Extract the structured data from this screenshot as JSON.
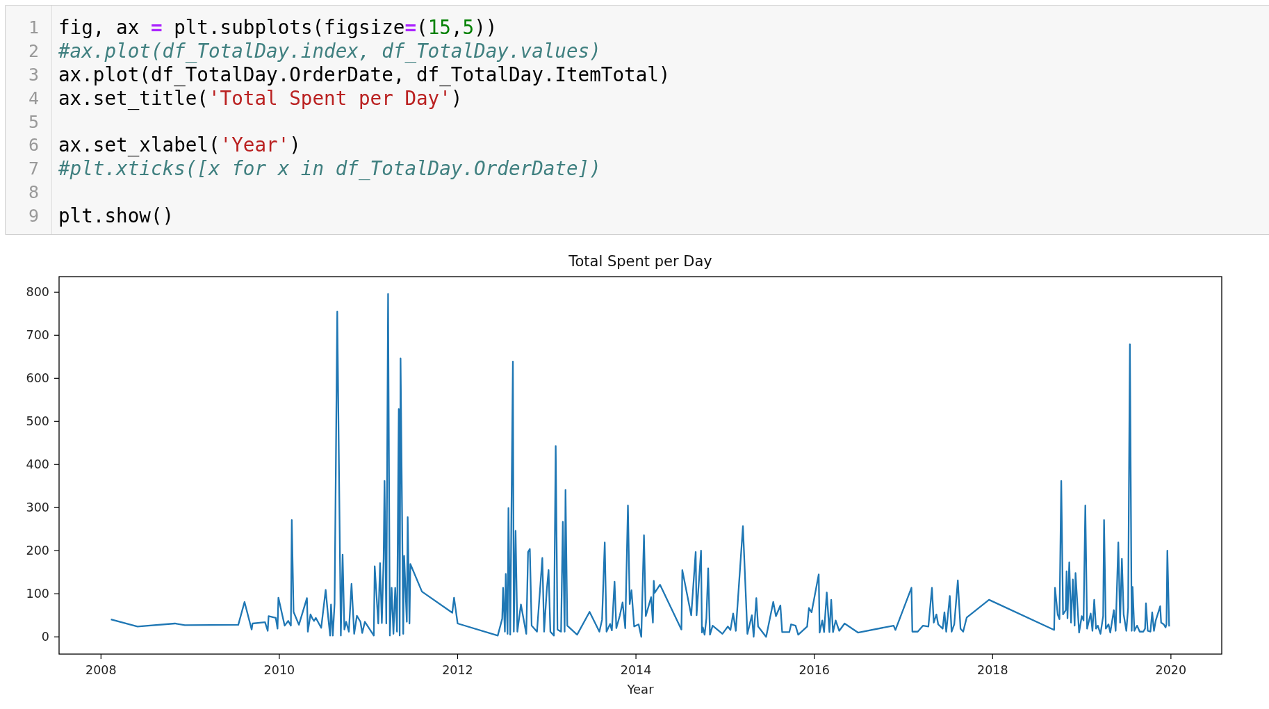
{
  "code_cell": {
    "lines": [
      {
        "number": "1",
        "tokens": [
          {
            "kind": "plain",
            "text": "fig, ax "
          },
          {
            "kind": "operator",
            "text": "="
          },
          {
            "kind": "plain",
            "text": " plt.subplots(figsize"
          },
          {
            "kind": "operator",
            "text": "="
          },
          {
            "kind": "plain",
            "text": "("
          },
          {
            "kind": "number",
            "text": "15"
          },
          {
            "kind": "plain",
            "text": ","
          },
          {
            "kind": "number",
            "text": "5"
          },
          {
            "kind": "plain",
            "text": "))"
          }
        ]
      },
      {
        "number": "2",
        "tokens": [
          {
            "kind": "comment",
            "text": "#ax.plot(df_TotalDay.index, df_TotalDay.values)"
          }
        ]
      },
      {
        "number": "3",
        "tokens": [
          {
            "kind": "plain",
            "text": "ax.plot(df_TotalDay.OrderDate, df_TotalDay.ItemTotal)"
          }
        ]
      },
      {
        "number": "4",
        "tokens": [
          {
            "kind": "plain",
            "text": "ax.set_title("
          },
          {
            "kind": "string",
            "text": "'Total Spent per Day'"
          },
          {
            "kind": "plain",
            "text": ")"
          }
        ]
      },
      {
        "number": "5"
      },
      {
        "number": "6",
        "tokens": [
          {
            "kind": "plain",
            "text": "ax.set_xlabel("
          },
          {
            "kind": "string",
            "text": "'Year'"
          },
          {
            "kind": "plain",
            "text": ")"
          }
        ]
      },
      {
        "number": "7",
        "tokens": [
          {
            "kind": "comment",
            "text": "#plt.xticks([x for x in df_TotalDay.OrderDate])"
          }
        ]
      },
      {
        "number": "8"
      },
      {
        "number": "9",
        "tokens": [
          {
            "kind": "plain",
            "text": "plt.show()"
          }
        ]
      }
    ]
  },
  "output": {
    "chart_data": {
      "type": "line",
      "title": "Total Spent per Day",
      "xlabel": "Year",
      "x": [
        2008.12,
        2008.41,
        2008.83,
        2008.94,
        2009.54,
        2009.61,
        2009.69,
        2009.7,
        2009.84,
        2009.87,
        2009.88,
        2009.96,
        2009.98,
        2009.99,
        2010.06,
        2010.1,
        2010.13,
        2010.14,
        2010.16,
        2010.22,
        2010.31,
        2010.32,
        2010.35,
        2010.37,
        2010.39,
        2010.41,
        2010.47,
        2010.52,
        2010.55,
        2010.57,
        2010.58,
        2010.6,
        2010.62,
        2010.65,
        2010.69,
        2010.71,
        2010.73,
        2010.75,
        2010.78,
        2010.81,
        2010.84,
        2010.87,
        2010.91,
        2010.93,
        2010.96,
        2011.06,
        2011.07,
        2011.11,
        2011.13,
        2011.15,
        2011.17,
        2011.18,
        2011.2,
        2011.22,
        2011.24,
        2011.26,
        2011.28,
        2011.3,
        2011.32,
        2011.34,
        2011.35,
        2011.36,
        2011.39,
        2011.4,
        2011.43,
        2011.44,
        2011.46,
        2011.47,
        2011.6,
        2011.94,
        2011.96,
        2012.0,
        2012.45,
        2012.5,
        2012.51,
        2012.53,
        2012.54,
        2012.56,
        2012.57,
        2012.59,
        2012.62,
        2012.63,
        2012.65,
        2012.67,
        2012.71,
        2012.77,
        2012.79,
        2012.81,
        2012.83,
        2012.89,
        2012.95,
        2012.97,
        2013.0,
        2013.02,
        2013.04,
        2013.08,
        2013.1,
        2013.12,
        2013.16,
        2013.18,
        2013.2,
        2013.21,
        2013.23,
        2013.34,
        2013.48,
        2013.59,
        2013.62,
        2013.65,
        2013.67,
        2013.71,
        2013.73,
        2013.76,
        2013.78,
        2013.82,
        2013.85,
        2013.88,
        2013.91,
        2013.93,
        2013.95,
        2013.98,
        2014.03,
        2014.06,
        2014.09,
        2014.11,
        2014.17,
        2014.19,
        2014.2,
        2014.21,
        2014.27,
        2014.51,
        2014.52,
        2014.62,
        2014.67,
        2014.68,
        2014.73,
        2014.74,
        2014.75,
        2014.77,
        2014.79,
        2014.81,
        2014.83,
        2014.86,
        2014.97,
        2015.03,
        2015.06,
        2015.09,
        2015.12,
        2015.2,
        2015.25,
        2015.3,
        2015.32,
        2015.35,
        2015.37,
        2015.46,
        2015.54,
        2015.57,
        2015.62,
        2015.64,
        2015.72,
        2015.74,
        2015.79,
        2015.82,
        2015.92,
        2015.94,
        2015.97,
        2016.05,
        2016.06,
        2016.09,
        2016.11,
        2016.14,
        2016.17,
        2016.19,
        2016.21,
        2016.24,
        2016.28,
        2016.34,
        2016.49,
        2016.89,
        2016.91,
        2017.09,
        2017.1,
        2017.16,
        2017.22,
        2017.28,
        2017.32,
        2017.34,
        2017.37,
        2017.39,
        2017.44,
        2017.46,
        2017.48,
        2017.52,
        2017.54,
        2017.57,
        2017.61,
        2017.64,
        2017.67,
        2017.71,
        2017.96,
        2018.69,
        2018.7,
        2018.73,
        2018.75,
        2018.77,
        2018.79,
        2018.82,
        2018.83,
        2018.84,
        2018.86,
        2018.88,
        2018.9,
        2018.92,
        2018.93,
        2018.97,
        2019.0,
        2019.02,
        2019.04,
        2019.06,
        2019.1,
        2019.12,
        2019.14,
        2019.16,
        2019.18,
        2019.21,
        2019.24,
        2019.25,
        2019.27,
        2019.3,
        2019.32,
        2019.36,
        2019.38,
        2019.41,
        2019.43,
        2019.45,
        2019.47,
        2019.5,
        2019.52,
        2019.54,
        2019.56,
        2019.57,
        2019.59,
        2019.62,
        2019.65,
        2019.69,
        2019.71,
        2019.72,
        2019.74,
        2019.77,
        2019.79,
        2019.81,
        2019.83,
        2019.88,
        2019.89,
        2019.92,
        2019.94,
        2019.95,
        2019.96,
        2019.98
      ],
      "series": [
        {
          "color": "#1f77b4",
          "values": [
            40,
            24,
            31,
            27,
            28,
            81,
            17,
            31,
            34,
            14,
            48,
            44,
            19,
            91,
            26,
            37,
            26,
            271,
            58,
            28,
            90,
            12,
            52,
            43,
            37,
            44,
            21,
            109,
            42,
            3,
            75,
            3,
            77,
            755,
            3,
            191,
            17,
            35,
            12,
            123,
            7,
            49,
            35,
            9,
            35,
            3,
            164,
            31,
            171,
            32,
            182,
            362,
            31,
            796,
            3,
            114,
            7,
            114,
            12,
            529,
            3,
            646,
            7,
            188,
            35,
            278,
            31,
            169,
            105,
            56,
            91,
            31,
            3,
            42,
            114,
            12,
            146,
            7,
            299,
            5,
            639,
            12,
            246,
            12,
            75,
            7,
            197,
            204,
            26,
            12,
            183,
            12,
            109,
            155,
            12,
            3,
            443,
            17,
            12,
            267,
            12,
            341,
            26,
            5,
            58,
            12,
            40,
            219,
            12,
            30,
            15,
            128,
            20,
            50,
            80,
            20,
            305,
            76,
            108,
            24,
            29,
            0,
            236,
            48,
            92,
            33,
            130,
            102,
            121,
            17,
            155,
            50,
            197,
            50,
            200,
            10,
            22,
            5,
            43,
            159,
            5,
            26,
            7,
            24,
            16,
            54,
            14,
            257,
            7,
            50,
            0,
            90,
            24,
            0,
            81,
            48,
            73,
            11,
            11,
            29,
            26,
            5,
            24,
            67,
            57,
            145,
            10,
            38,
            11,
            103,
            11,
            86,
            11,
            38,
            14,
            31,
            10,
            26,
            16,
            114,
            12,
            12,
            26,
            24,
            114,
            33,
            52,
            29,
            19,
            57,
            12,
            95,
            12,
            29,
            131,
            19,
            12,
            45,
            86,
            16,
            114,
            52,
            41,
            362,
            52,
            62,
            152,
            43,
            173,
            33,
            133,
            26,
            148,
            10,
            48,
            38,
            305,
            19,
            54,
            14,
            86,
            19,
            26,
            7,
            48,
            271,
            19,
            29,
            10,
            62,
            14,
            219,
            33,
            181,
            52,
            14,
            67,
            679,
            14,
            116,
            14,
            26,
            12,
            12,
            19,
            78,
            14,
            12,
            57,
            14,
            38,
            71,
            33,
            29,
            22,
            29,
            200,
            26
          ]
        }
      ],
      "xlim": [
        2007.53,
        2020.57
      ],
      "ylim": [
        -40,
        836
      ],
      "xticks": [
        2008,
        2010,
        2012,
        2014,
        2016,
        2018,
        2020
      ],
      "yticks": [
        0,
        100,
        200,
        300,
        400,
        500,
        600,
        700,
        800
      ]
    }
  }
}
